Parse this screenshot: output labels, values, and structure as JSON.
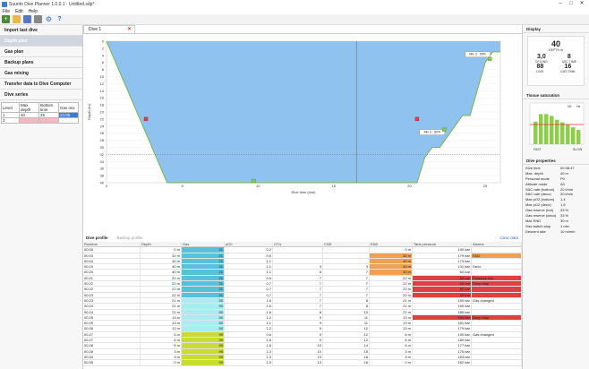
{
  "window": {
    "title": "Suunto Dive Planner 1.0.0.1 - Untitled.sdp*"
  },
  "menu": [
    "File",
    "Edit",
    "Help"
  ],
  "left": {
    "items": [
      "Import last dive",
      "Depth plan",
      "Gas plan",
      "Backup plans",
      "Gas mixing",
      "Transfer data to Dive Computer",
      "Dive series"
    ],
    "table": {
      "headers": [
        "Level",
        "Max depth",
        "Bottom time",
        "Gas mix"
      ],
      "rows": [
        [
          "1",
          "40",
          "25",
          "21/35"
        ],
        [
          "2",
          "",
          "",
          ""
        ]
      ]
    }
  },
  "tabs": {
    "dive": "Dive 1"
  },
  "chart_data": {
    "type": "line",
    "title": "",
    "xlabel": "Dive time (min)",
    "ylabel": "Depth (m)",
    "xlim": [
      0,
      26
    ],
    "ylim": [
      40,
      0
    ],
    "x_ticks": [
      0,
      5,
      10,
      15,
      20,
      25
    ],
    "y_ticks": [
      0,
      2,
      4,
      6,
      8,
      10,
      12,
      14,
      16,
      18,
      20,
      22,
      24,
      26,
      28,
      30,
      32,
      34,
      36,
      38,
      40
    ],
    "series": [
      {
        "values": [
          [
            0,
            0
          ],
          [
            4,
            40
          ],
          [
            10,
            40
          ],
          [
            17,
            40
          ],
          [
            20.5,
            40
          ],
          [
            21,
            33
          ],
          [
            21.5,
            30
          ],
          [
            22,
            30
          ],
          [
            22.5,
            27
          ],
          [
            23,
            24
          ],
          [
            23.5,
            21
          ],
          [
            24,
            21
          ],
          [
            25,
            6
          ],
          [
            25.5,
            3
          ],
          [
            26,
            3
          ]
        ]
      }
    ],
    "annotations": [
      {
        "text": "Mix 2 - 50%",
        "x": 21.5,
        "y": 28
      },
      {
        "text": "Mix 3 - 99%",
        "x": 24.5,
        "y": 6
      }
    ]
  },
  "profile": {
    "tab_active": "Dive profile",
    "tab_other": "Backup profile",
    "clear_label": "Clear data"
  },
  "grid": {
    "headers": [
      "Runtime",
      "Depth",
      "Gas",
      "pO2",
      "OTU",
      "CNS",
      "END",
      "Tank pressure",
      "Alarms"
    ],
    "rows": [
      [
        "00:00",
        "0 m",
        "21",
        "0.2",
        "",
        "",
        "0 m",
        "190 bar",
        ""
      ],
      [
        "00:03",
        "32 m",
        "21",
        "0.9",
        "",
        "",
        "32 m",
        "179 bar",
        "END"
      ],
      [
        "00:04",
        "40 m",
        "21",
        "1.1",
        "",
        "",
        "40 m",
        "174 bar",
        ""
      ],
      [
        "00:10",
        "40 m",
        "21",
        "1.1",
        "3",
        "3",
        "40 m",
        "131 bar",
        "Deco"
      ],
      [
        "00:20",
        "40 m",
        "21",
        "1.1",
        "6",
        "7",
        "40 m",
        "60 bar",
        ""
      ],
      [
        "00:21",
        "22 m",
        "21",
        "0.9",
        "7",
        "7",
        "22 m",
        "60 bar",
        "Pressure low"
      ],
      [
        "00:22",
        "22 m",
        "21",
        "0.7",
        "7",
        "7",
        "22 m",
        "55 bar",
        "Deep stop"
      ],
      [
        "00:22",
        "22 m",
        "21",
        "0.7",
        "7",
        "7",
        "22 m",
        "52 bar",
        ""
      ],
      [
        "00:23",
        "22 m",
        "21",
        "0.7",
        "7",
        "7",
        "22 m",
        "49 bar",
        ""
      ],
      [
        "00:23",
        "21 m",
        "50",
        "1.6",
        "7",
        "8",
        "21 m",
        "190 bar",
        "Gas changed"
      ],
      [
        "00:24",
        "21 m",
        "50",
        "1.6",
        "7",
        "8",
        "21 m",
        "190 bar",
        ""
      ],
      [
        "00:24",
        "21 m",
        "50",
        "1.6",
        "8",
        "10",
        "21 m",
        "185 bar",
        ""
      ],
      [
        "00:25",
        "13 m",
        "50",
        "1.2",
        "9",
        "11",
        "13 m",
        "183 bar",
        "Deep stop"
      ],
      [
        "00:25",
        "13 m",
        "50",
        "1.1",
        "9",
        "11",
        "13 m",
        "181 bar",
        ""
      ],
      [
        "00:26",
        "13 m",
        "50",
        "1.2",
        "9",
        "12",
        "13 m",
        "179 bar",
        ""
      ],
      [
        "00:27",
        "6 m",
        "99",
        "0.6",
        "9",
        "12",
        "6 m",
        "190 bar",
        "Gas changed"
      ],
      [
        "00:27",
        "6 m",
        "99",
        "1.6",
        "9",
        "12",
        "6 m",
        "180 bar",
        ""
      ],
      [
        "00:28",
        "6 m",
        "99",
        "1.6",
        "10",
        "14",
        "6 m",
        "177 bar",
        ""
      ],
      [
        "00:28",
        "3 m",
        "99",
        "1.3",
        "10",
        "15",
        "3 m",
        "176 bar",
        ""
      ],
      [
        "00:34",
        "3 m",
        "99",
        "1.3",
        "13",
        "18",
        "3 m",
        "163 bar",
        ""
      ],
      [
        "00:35",
        "0 m",
        "99",
        "1.0",
        "13",
        "18",
        "0 m",
        "162 bar",
        ""
      ]
    ]
  },
  "display": {
    "title": "Display",
    "depth": "40",
    "depth_lbl": "DEPTH m",
    "ceil": "3,0",
    "ceil_lbl": "CEILING",
    "asc": "8",
    "asc_lbl": "ASC TIME",
    "dive": "88",
    "dive_lbl": "DIVE",
    "gas": "16",
    "gas_lbl": "GAS TIME"
  },
  "tissue": {
    "title": "Tissue saturation",
    "legend_n2": "N2",
    "legend_he": "He",
    "fast": "FAST",
    "slow": "SLOW",
    "n2": [
      60,
      80,
      80,
      75,
      65,
      58,
      52,
      45,
      38
    ]
  },
  "properties": {
    "title": "Dive properties",
    "items": [
      [
        "Dive time",
        "00:38:47"
      ],
      [
        "Max. depth",
        "40 m"
      ],
      [
        "Personal mode",
        "P0"
      ],
      [
        "Altitude mode",
        "A0"
      ],
      [
        "SAC rate (bottom)",
        "20 l/min"
      ],
      [
        "SAC rate (deco)",
        "20 l/min"
      ],
      [
        "Max pO2 (bottom)",
        "1,4"
      ],
      [
        "Max pO2 (deco)",
        "1,6"
      ],
      [
        "Gas reserve (bot)",
        "33 %"
      ],
      [
        "Gas reserve (deco)",
        "33 %"
      ],
      [
        "Max END",
        "30 m"
      ],
      [
        "Gas switch stop",
        "1 min"
      ],
      [
        "Descent rate",
        "10 m/min"
      ]
    ]
  }
}
